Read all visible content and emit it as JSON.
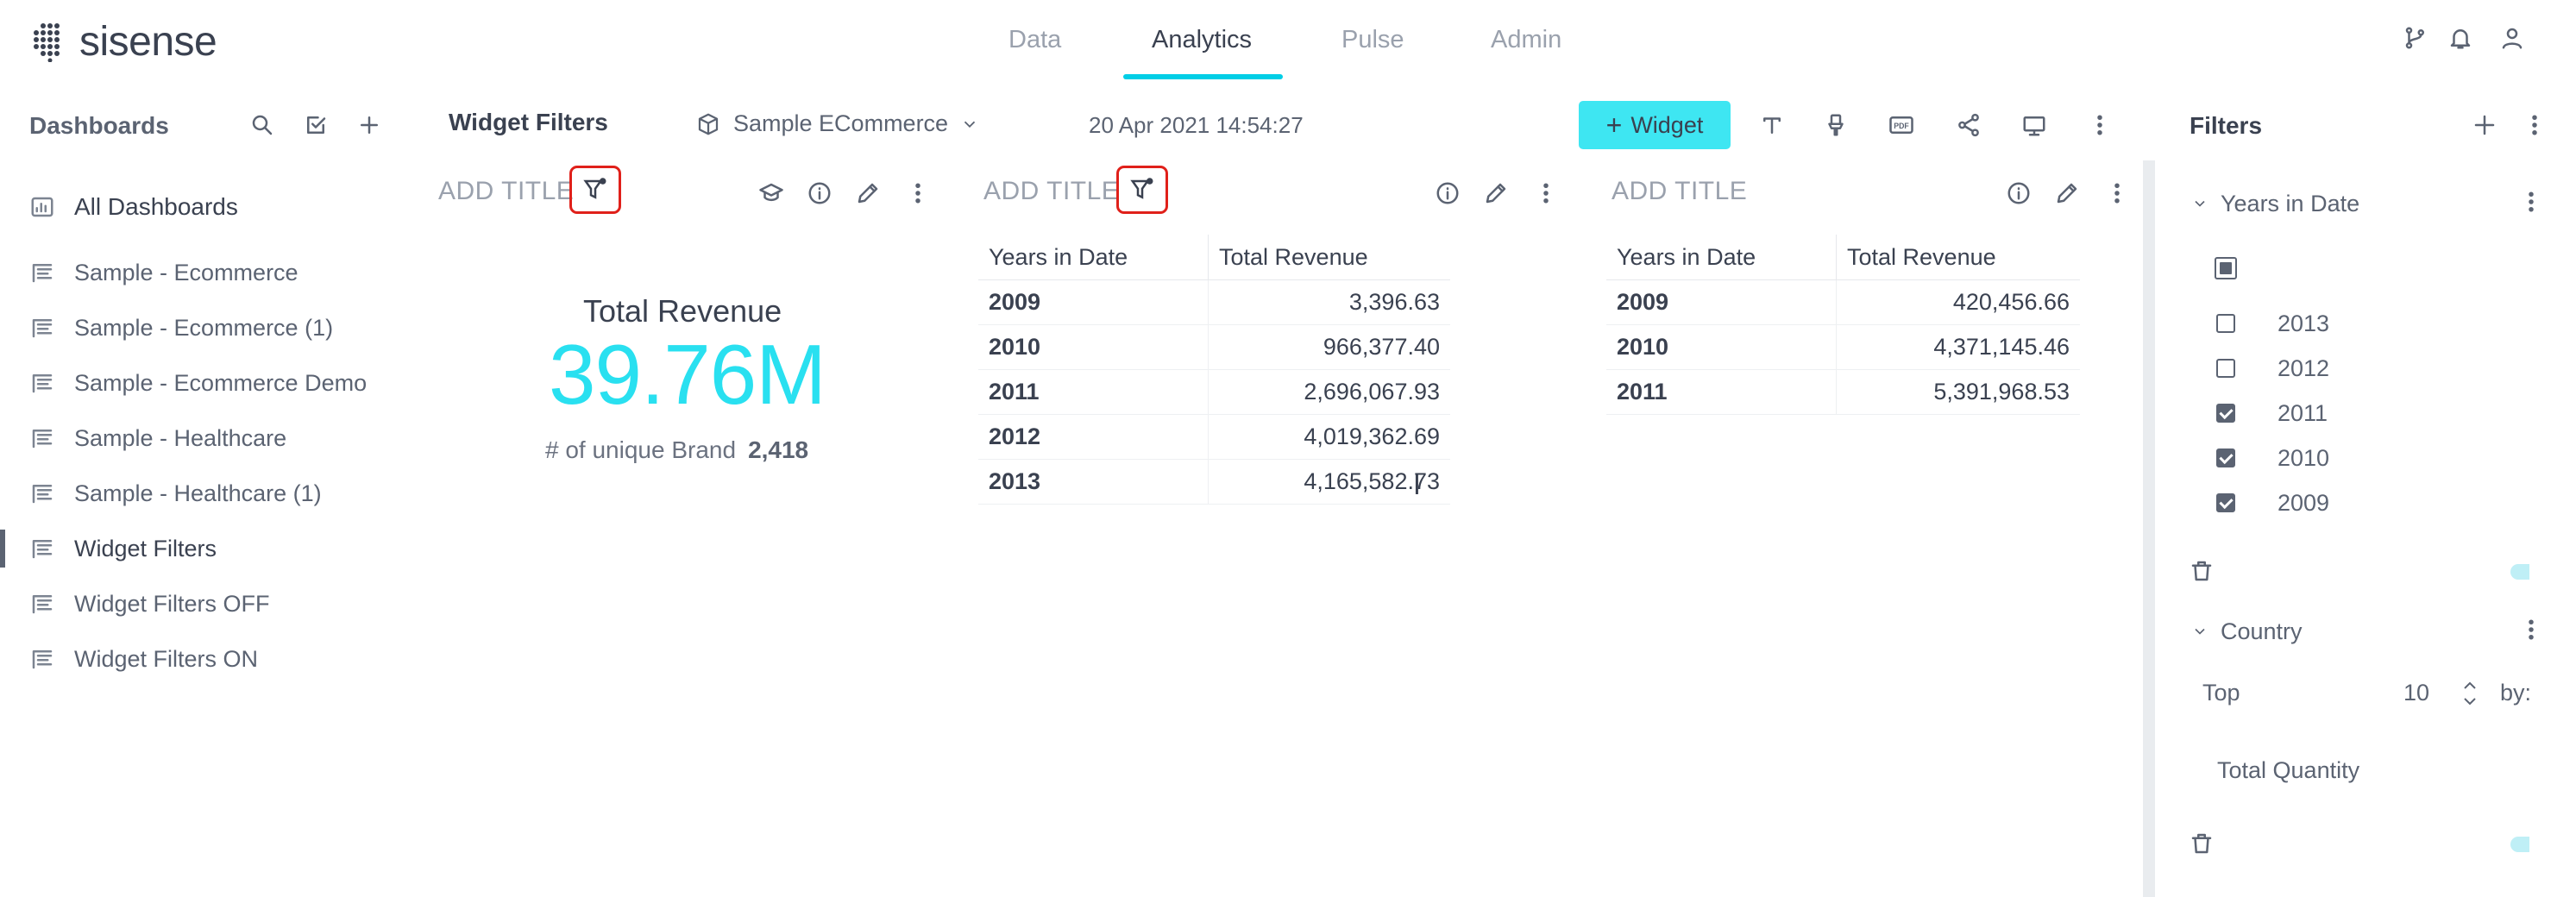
{
  "app": {
    "logo_text": "sisense",
    "nav_tabs": [
      "Data",
      "Analytics",
      "Pulse",
      "Admin"
    ],
    "active_tab": "Analytics"
  },
  "sidebar": {
    "title": "Dashboards",
    "all_label": "All Dashboards",
    "items": [
      {
        "label": "Sample - Ecommerce"
      },
      {
        "label": "Sample - Ecommerce (1)"
      },
      {
        "label": "Sample - Ecommerce Demo"
      },
      {
        "label": "Sample - Healthcare"
      },
      {
        "label": "Sample - Healthcare (1)"
      },
      {
        "label": "Widget Filters",
        "active": true
      },
      {
        "label": "Widget Filters OFF"
      },
      {
        "label": "Widget Filters ON"
      }
    ]
  },
  "toolbar": {
    "dashboard_title": "Widget Filters",
    "datasource": "Sample ECommerce",
    "timestamp": "20 Apr 2021 14:54:27",
    "widget_button": "Widget"
  },
  "widgets": {
    "w1": {
      "title": "ADD TITLE",
      "kpi_label": "Total Revenue",
      "kpi_value": "39.76M",
      "sub_label": "# of unique Brand",
      "sub_value": "2,418"
    },
    "w2": {
      "title": "ADD TITLE",
      "columns": [
        "Years in Date",
        "Total Revenue"
      ],
      "rows": [
        {
          "year": "2009",
          "value": "3,396.63"
        },
        {
          "year": "2010",
          "value": "966,377.40"
        },
        {
          "year": "2011",
          "value": "2,696,067.93"
        },
        {
          "year": "2012",
          "value": "4,019,362.69"
        },
        {
          "year": "2013",
          "value": "4,165,582.73"
        }
      ]
    },
    "w3": {
      "title": "ADD TITLE",
      "columns": [
        "Years in Date",
        "Total Revenue"
      ],
      "rows": [
        {
          "year": "2009",
          "value": "420,456.66"
        },
        {
          "year": "2010",
          "value": "4,371,145.46"
        },
        {
          "year": "2011",
          "value": "5,391,968.53"
        }
      ]
    }
  },
  "filters_panel": {
    "title": "Filters",
    "years_filter": {
      "label": "Years in Date",
      "options": [
        {
          "label": "2013",
          "checked": false
        },
        {
          "label": "2012",
          "checked": false
        },
        {
          "label": "2011",
          "checked": true
        },
        {
          "label": "2010",
          "checked": true
        },
        {
          "label": "2009",
          "checked": true
        }
      ]
    },
    "country_filter": {
      "label": "Country",
      "top_label": "Top",
      "top_value": "10",
      "by_label": "by:",
      "measure": "Total Quantity"
    }
  },
  "colors": {
    "accent": "#00cee6",
    "kpi": "#29e0f0",
    "button": "#3ee6f2",
    "highlight_border": "#e0201a"
  }
}
